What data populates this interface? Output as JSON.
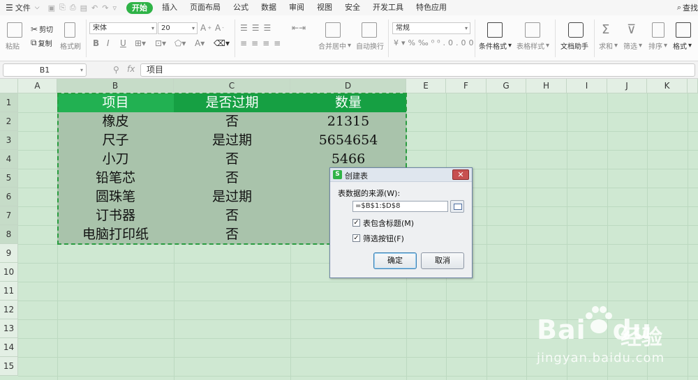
{
  "menubar": {
    "file_label": "文件",
    "tabs": [
      {
        "label": "开始",
        "active": true
      },
      {
        "label": "插入"
      },
      {
        "label": "页面布局"
      },
      {
        "label": "公式"
      },
      {
        "label": "数据"
      },
      {
        "label": "审阅"
      },
      {
        "label": "视图"
      },
      {
        "label": "安全"
      },
      {
        "label": "开发工具"
      },
      {
        "label": "特色应用"
      }
    ],
    "search_label": "查找"
  },
  "ribbon": {
    "paste": "粘贴",
    "cut": "剪切",
    "copy": "复制",
    "format_painter": "格式刷",
    "font_name": "宋体",
    "font_size": "20",
    "merge_center": "合并居中",
    "wrap_text": "自动换行",
    "number_format": "常规",
    "conditional_format": "条件格式",
    "table_style": "表格样式",
    "doc_assistant": "文档助手",
    "sum": "求和",
    "filter": "筛选",
    "sort": "排序",
    "format": "格式"
  },
  "formula_bar": {
    "name_box": "B1",
    "fx_label": "fx",
    "formula": "项目"
  },
  "columns": [
    "A",
    "B",
    "C",
    "D",
    "E",
    "F",
    "G",
    "H",
    "I",
    "J",
    "K"
  ],
  "rows": [
    "1",
    "2",
    "3",
    "4",
    "5",
    "6",
    "7",
    "8",
    "9",
    "10",
    "11",
    "12",
    "13",
    "14",
    "15"
  ],
  "table": {
    "header": [
      "项目",
      "是否过期",
      "数量"
    ],
    "rows": [
      [
        "橡皮",
        "否",
        "21315"
      ],
      [
        "尺子",
        "是过期",
        "5654654"
      ],
      [
        "小刀",
        "否",
        "5466"
      ],
      [
        "铅笔芯",
        "否",
        ""
      ],
      [
        "圆珠笔",
        "是过期",
        ""
      ],
      [
        "订书器",
        "否",
        ""
      ],
      [
        "电脑打印纸",
        "否",
        ""
      ]
    ]
  },
  "dialog": {
    "icon_letter": "S",
    "title": "创建表",
    "close_symbol": "✕",
    "source_label": "表数据的来源(W):",
    "source_value": "=$B$1:$D$8",
    "include_headers_label": "表包含标题(M)",
    "include_headers_checked": "✓",
    "filter_buttons_label": "筛选按钮(F)",
    "filter_buttons_checked": "✓",
    "ok_label": "确定",
    "cancel_label": "取消"
  },
  "watermark": {
    "logo_bai": "Bai",
    "logo_du": "du",
    "logo_cn": "经验",
    "url": "jingyan.baidu.com"
  },
  "colors": {
    "accent": "#2fb347",
    "sheet_bg": "#cfe8d2",
    "header_row": "#16a043",
    "selected_range": "#a9c3ab"
  }
}
